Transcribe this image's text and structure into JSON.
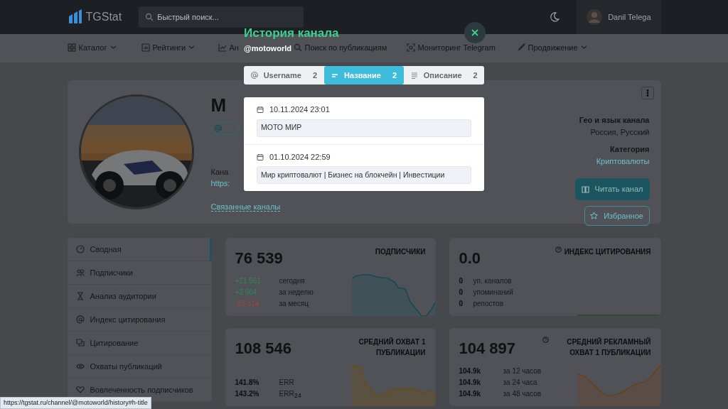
{
  "header": {
    "logo": "TGStat",
    "search": {
      "placeholder": "Быстрый поиск..."
    },
    "user": "Danil Telega"
  },
  "menu": [
    {
      "label": "Каталог",
      "dropdown": true
    },
    {
      "label": "Рейтинги",
      "dropdown": true
    },
    {
      "label": "Ан",
      "dropdown": false
    },
    {
      "label": "Поиск по публикациям",
      "dropdown": false
    },
    {
      "label": "Мониторинг Telegram",
      "dropdown": false
    },
    {
      "label": "Продвижение",
      "dropdown": true
    }
  ],
  "channel": {
    "title": "М",
    "description_label": "Кана",
    "link": "https:",
    "related": "Связанные каналы",
    "geo_label": "Гео и язык канала",
    "geo": "Россия, Русский",
    "category_label": "Категория",
    "category": "Криптовалюты",
    "read_button": "Читать канал",
    "favorite_button": "Избранное"
  },
  "sidebar": [
    {
      "label": "Сводная",
      "selected": true
    },
    {
      "label": "Подписчики",
      "selected": false
    },
    {
      "label": "Анализ аудитории",
      "selected": false
    },
    {
      "label": "Индекс цитирования",
      "selected": false
    },
    {
      "label": "Цитирование",
      "selected": false
    },
    {
      "label": "Охваты публикаций",
      "selected": false
    },
    {
      "label": "Вовлеченность подписчиков",
      "selected": false
    }
  ],
  "stats": [
    {
      "value": "76 539",
      "title": "ПОДПИСЧИКИ",
      "help": false,
      "rows": [
        {
          "value": "+21 561",
          "label": "сегодня",
          "color": "#2f8a56"
        },
        {
          "value": "+2 904",
          "label": "за неделю",
          "color": "#2f8a56"
        },
        {
          "value": "-53 314",
          "label": "за месяц",
          "color": "#a8443a"
        }
      ]
    },
    {
      "value": "0.0",
      "title": "ИНДЕКС ЦИТИРОВАНИЯ",
      "help": true,
      "rows": [
        {
          "value": "0",
          "label": "уп. каналов"
        },
        {
          "value": "0",
          "label": "упоминаний"
        },
        {
          "value": "0",
          "label": "репостов"
        }
      ]
    },
    {
      "value": "108 546",
      "title": "СРЕДНИЙ ОХВАТ 1 ПУБЛИКАЦИИ",
      "help": false,
      "rows": [
        {
          "value": "141.8%",
          "label": "ERR"
        },
        {
          "value": "143.2%",
          "label": "ERR$_{24}$"
        }
      ]
    },
    {
      "value": "104 897",
      "title": "СРЕДНИЙ РЕКЛАМНЫЙ ОХВАТ 1 ПУБЛИКАЦИИ",
      "help": true,
      "rows": [
        {
          "value": "104.9k",
          "label": "за 12 часов"
        },
        {
          "value": "104.9k",
          "label": "за 24 часа"
        },
        {
          "value": "104.9k",
          "label": "за 48 часов"
        }
      ]
    }
  ],
  "modal": {
    "title": "История канала",
    "handle": "@motoworld",
    "tabs": [
      {
        "label": "Username",
        "count": "2",
        "selected": false
      },
      {
        "label": "Название",
        "count": "2",
        "selected": true
      },
      {
        "label": "Описание",
        "count": "2",
        "selected": false
      }
    ],
    "entries": [
      {
        "date": "10.11.2024 23:01",
        "value": "МОТО МИР"
      },
      {
        "date": "01.10.2024 22:59",
        "value": "Мир криптовалют | Бизнес на блокчейн | Инвестиции"
      }
    ]
  },
  "status_bar": "https://tgstat.ru/channel/@motoworld/history#h-title"
}
